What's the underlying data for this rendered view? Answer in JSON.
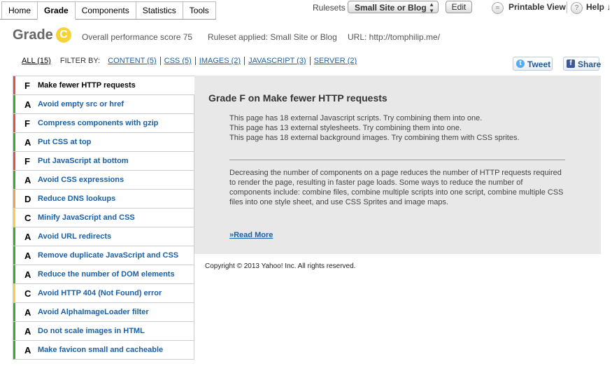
{
  "tabs": [
    {
      "label": "Home",
      "active": false
    },
    {
      "label": "Grade",
      "active": true
    },
    {
      "label": "Components",
      "active": false
    },
    {
      "label": "Statistics",
      "active": false
    },
    {
      "label": "Tools",
      "active": false
    }
  ],
  "toolbar": {
    "rulesets_label": "Rulesets",
    "ruleset_selected": "Small Site or Blog",
    "edit_label": "Edit",
    "printable_label": "Printable View",
    "help_label": "Help ↓"
  },
  "header": {
    "grade_label": "Grade",
    "grade_letter": "C",
    "score_text": "Overall performance score 75",
    "ruleset_text": "Ruleset applied: Small Site or Blog",
    "url_text": "URL: http://tomphilip.me/"
  },
  "filter": {
    "all_label": "ALL (15)",
    "filter_by_label": "FILTER BY:",
    "links": [
      "CONTENT (5)",
      "CSS (5)",
      "IMAGES (2)",
      "JAVASCRIPT (3)",
      "SERVER (2)"
    ]
  },
  "social": {
    "tweet_label": "Tweet",
    "share_label": "Share"
  },
  "colors": {
    "F": "#e05050",
    "A": "#3aaa35",
    "D": "#f0a050",
    "C": "#f5d33a"
  },
  "rules": [
    {
      "grade": "F",
      "name": "Make fewer HTTP requests",
      "active": true
    },
    {
      "grade": "A",
      "name": "Avoid empty src or href",
      "active": false
    },
    {
      "grade": "F",
      "name": "Compress components with gzip",
      "active": false
    },
    {
      "grade": "A",
      "name": "Put CSS at top",
      "active": false
    },
    {
      "grade": "F",
      "name": "Put JavaScript at bottom",
      "active": false
    },
    {
      "grade": "A",
      "name": "Avoid CSS expressions",
      "active": false
    },
    {
      "grade": "D",
      "name": "Reduce DNS lookups",
      "active": false
    },
    {
      "grade": "C",
      "name": "Minify JavaScript and CSS",
      "active": false
    },
    {
      "grade": "A",
      "name": "Avoid URL redirects",
      "active": false
    },
    {
      "grade": "A",
      "name": "Remove duplicate JavaScript and CSS",
      "active": false
    },
    {
      "grade": "A",
      "name": "Reduce the number of DOM elements",
      "active": false
    },
    {
      "grade": "C",
      "name": "Avoid HTTP 404 (Not Found) error",
      "active": false
    },
    {
      "grade": "A",
      "name": "Avoid AlphaImageLoader filter",
      "active": false
    },
    {
      "grade": "A",
      "name": "Do not scale images in HTML",
      "active": false
    },
    {
      "grade": "A",
      "name": "Make favicon small and cacheable",
      "active": false
    }
  ],
  "detail": {
    "title": "Grade F on Make fewer HTTP requests",
    "messages": [
      "This page has 18 external Javascript scripts. Try combining them into one.",
      "This page has 13 external stylesheets. Try combining them into one.",
      "This page has 18 external background images. Try combining them with CSS sprites."
    ],
    "description": "Decreasing the number of components on a page reduces the number of HTTP requests required to render the page, resulting in faster page loads. Some ways to reduce the number of components include: combine files, combine multiple scripts into one script, combine multiple CSS files into one style sheet, and use CSS Sprites and image maps.",
    "read_more": "»Read More"
  },
  "footer": {
    "copyright": "Copyright © 2013 Yahoo! Inc. All rights reserved."
  }
}
